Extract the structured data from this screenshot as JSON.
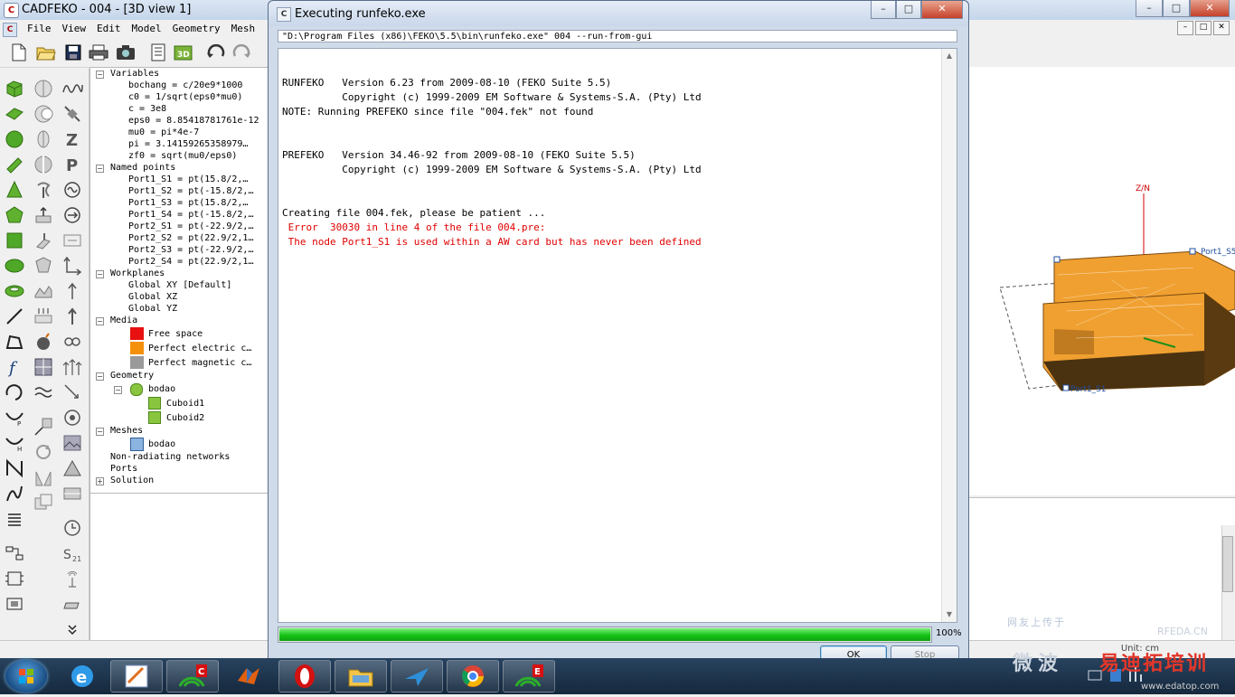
{
  "main_window": {
    "title": "CADFEKO - 004 - [3D view 1]",
    "menu": [
      "File",
      "View",
      "Edit",
      "Model",
      "Geometry",
      "Mesh"
    ],
    "minimize": "–",
    "maximize": "□",
    "close": "✕"
  },
  "tree": {
    "variables_label": "Variables",
    "variables": [
      "bochang = c/20e9*1000",
      "c0 = 1/sqrt(eps0*mu0)",
      "c = 3e8",
      "eps0 = 8.85418781761e-12",
      "mu0 = pi*4e-7",
      "pi = 3.14159265358979…",
      "zf0 = sqrt(mu0/eps0)"
    ],
    "named_points_label": "Named points",
    "named_points": [
      "Port1_S1 = pt(15.8/2,…",
      "Port1_S2 = pt(-15.8/2,…",
      "Port1_S3 = pt(15.8/2,…",
      "Port1_S4 = pt(-15.8/2,…",
      "Port2_S1 = pt(-22.9/2,…",
      "Port2_S2 = pt(22.9/2,1…",
      "Port2_S3 = pt(-22.9/2,…",
      "Port2_S4 = pt(22.9/2,1…"
    ],
    "workplanes_label": "Workplanes",
    "workplanes": [
      "Global XY [Default]",
      "Global XZ",
      "Global YZ"
    ],
    "media_label": "Media",
    "media": [
      {
        "name": "Free space",
        "color": "#e81010"
      },
      {
        "name": "Perfect electric c…",
        "color": "#f5900a"
      },
      {
        "name": "Perfect magnetic c…",
        "color": "#9a9a9a"
      }
    ],
    "geometry_label": "Geometry",
    "geometry_part": "bodao",
    "geometry_children": [
      "Cuboid1",
      "Cuboid2"
    ],
    "meshes_label": "Meshes",
    "mesh_item": "bodao",
    "non_radiating_label": "Non-radiating networks",
    "ports_label": "Ports",
    "solution_label": "Solution",
    "expand_minus": "−",
    "expand_plus": "+"
  },
  "view3d": {
    "axis_label": "Z/N",
    "point_label_1": "Port1_S5",
    "point_label_2": "Port1_S1"
  },
  "dialog": {
    "title": "Executing runfeko.exe",
    "command_line": "\"D:\\Program Files (x86)\\FEKO\\5.5\\bin\\runfeko.exe\" 004 --run-from-gui",
    "output_lines": [
      {
        "text": "RUNFEKO   Version 6.23 from 2009-08-10 (FEKO Suite 5.5)",
        "error": false
      },
      {
        "text": "          Copyright (c) 1999-2009 EM Software & Systems-S.A. (Pty) Ltd",
        "error": false
      },
      {
        "text": "NOTE: Running PREFEKO since file \"004.fek\" not found",
        "error": false
      },
      {
        "text": "",
        "error": false
      },
      {
        "text": "",
        "error": false
      },
      {
        "text": "",
        "error": false
      },
      {
        "text": "PREFEKO   Version 34.46-92 from 2009-08-10 (FEKO Suite 5.5)",
        "error": false
      },
      {
        "text": "          Copyright (c) 1999-2009 EM Software & Systems-S.A. (Pty) Ltd",
        "error": false
      },
      {
        "text": "",
        "error": false
      },
      {
        "text": "",
        "error": false
      },
      {
        "text": "",
        "error": false
      },
      {
        "text": "Creating file 004.fek, please be patient ...",
        "error": false
      },
      {
        "text": " Error  30030 in line 4 of the file 004.pre:",
        "error": true
      },
      {
        "text": " The node Port1_S1 is used within a AW card but has never been defined",
        "error": true
      }
    ],
    "progress_percent": 100,
    "progress_label": "100%",
    "ok_label": "OK",
    "stop_label": "Stop",
    "minimize": "–",
    "maximize": "□",
    "close": "✕",
    "scroll_up": "▲",
    "scroll_down": "▼"
  },
  "statusbar": {
    "unit": "Unit: cm"
  },
  "watermarks": {
    "w1": "网友上传于",
    "w2": "RFEDA.CN",
    "w3": "微波",
    "w4": "易迪拓培训",
    "w5": "www.edatop.com"
  },
  "colors": {
    "accent_green": "#16c216",
    "error_red": "#e00000",
    "model_orange": "#f0a030"
  }
}
